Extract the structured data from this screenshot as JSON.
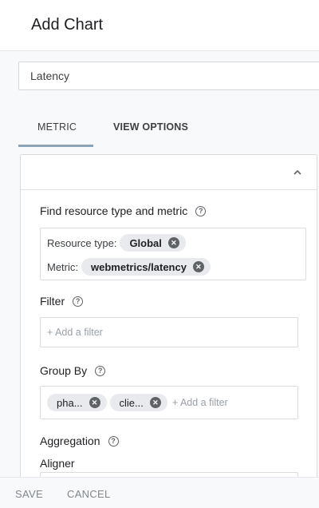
{
  "header": {
    "title": "Add Chart"
  },
  "chart_title_input": {
    "value": "Latency"
  },
  "tabs": [
    {
      "label": "METRIC"
    },
    {
      "label": "VIEW OPTIONS"
    }
  ],
  "metric": {
    "find_label": "Find resource type and metric",
    "resource_type_label": "Resource type:",
    "resource_type_value": "Global",
    "metric_label": "Metric:",
    "metric_value": "webmetrics/latency",
    "filter_label": "Filter",
    "filter_placeholder": "+ Add a filter",
    "group_by_label": "Group By",
    "group_by_chips": [
      "pha...",
      "clie..."
    ],
    "group_by_placeholder": "+ Add a filter",
    "aggregation_label": "Aggregation",
    "aligner_label": "Aligner"
  },
  "footer": {
    "save_label": "SAVE",
    "cancel_label": "CANCEL"
  }
}
